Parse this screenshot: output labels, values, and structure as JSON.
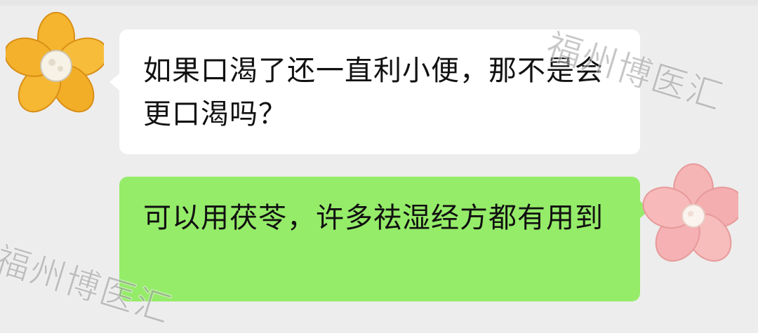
{
  "chat": {
    "messages": [
      {
        "side": "incoming",
        "avatar": "yellow-flower-avatar",
        "text": "如果口渴了还一直利小便，那不是会更口渴吗？"
      },
      {
        "side": "outgoing",
        "avatar": "pink-flower-avatar",
        "text": "可以用茯苓，许多祛湿经方都有用到"
      }
    ]
  },
  "watermark": {
    "text_top": "福州博医汇",
    "text_bottom": "福州博医汇"
  },
  "colors": {
    "background": "#ededed",
    "incoming_bubble": "#ffffff",
    "outgoing_bubble": "#95ec69",
    "yellow_petal": "#f5b52e",
    "pink_petal": "#f6b5b5"
  }
}
